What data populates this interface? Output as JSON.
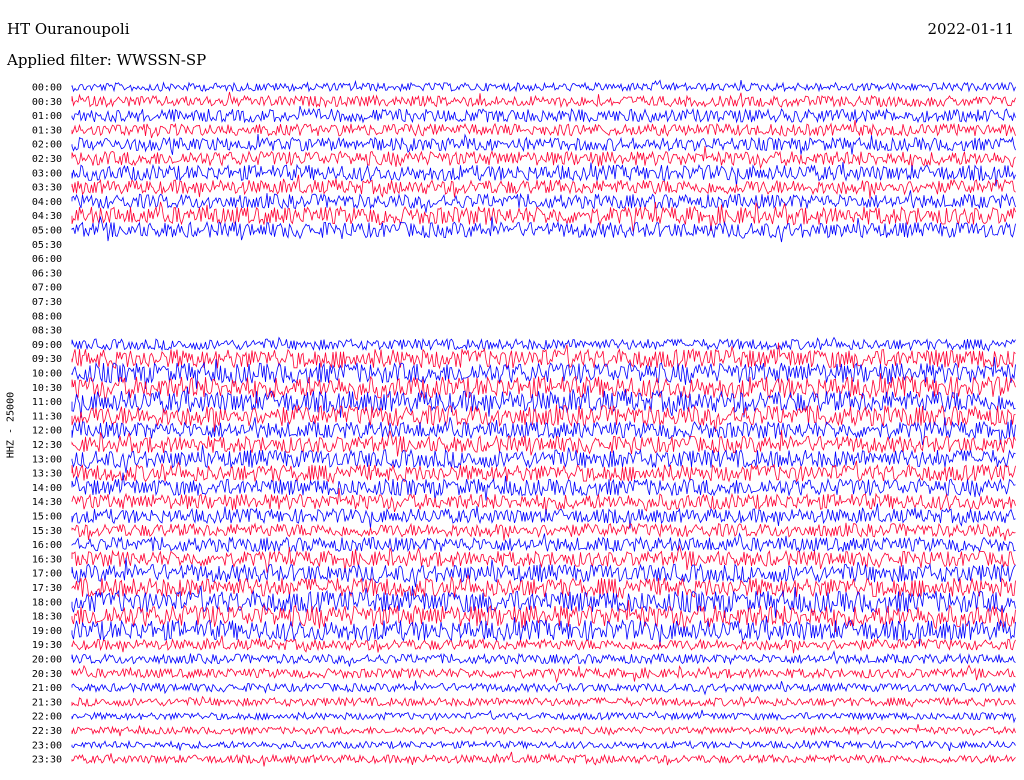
{
  "header": {
    "station": "HT Ouranoupoli",
    "date": "2022-01-11",
    "filter": "Applied filter: WWSSN-SP"
  },
  "chart_data": {
    "type": "line",
    "title": "HT Ouranoupoli",
    "ylabel": "HHZ - 25000",
    "series_colors": [
      "#0000ff",
      "#ff0033"
    ],
    "rows": [
      {
        "time": "00:00",
        "level": 0.35
      },
      {
        "time": "00:30",
        "level": 0.45
      },
      {
        "time": "01:00",
        "level": 0.55
      },
      {
        "time": "01:30",
        "level": 0.5
      },
      {
        "time": "02:00",
        "level": 0.55
      },
      {
        "time": "02:30",
        "level": 0.6
      },
      {
        "time": "03:00",
        "level": 0.65
      },
      {
        "time": "03:30",
        "level": 0.6
      },
      {
        "time": "04:00",
        "level": 0.6
      },
      {
        "time": "04:30",
        "level": 0.75
      },
      {
        "time": "05:00",
        "level": 0.65
      },
      {
        "time": "05:30",
        "level": 0
      },
      {
        "time": "06:00",
        "level": 0
      },
      {
        "time": "06:30",
        "level": 0
      },
      {
        "time": "07:00",
        "level": 0
      },
      {
        "time": "07:30",
        "level": 0
      },
      {
        "time": "08:00",
        "level": 0
      },
      {
        "time": "08:30",
        "level": 0
      },
      {
        "time": "09:00",
        "level": 0.45
      },
      {
        "time": "09:30",
        "level": 0.8
      },
      {
        "time": "10:00",
        "level": 0.85
      },
      {
        "time": "10:30",
        "level": 0.9
      },
      {
        "time": "11:00",
        "level": 0.9
      },
      {
        "time": "11:30",
        "level": 0.85
      },
      {
        "time": "12:00",
        "level": 0.7
      },
      {
        "time": "12:30",
        "level": 0.7
      },
      {
        "time": "13:00",
        "level": 0.75
      },
      {
        "time": "13:30",
        "level": 0.7
      },
      {
        "time": "14:00",
        "level": 0.7
      },
      {
        "time": "14:30",
        "level": 0.65
      },
      {
        "time": "15:00",
        "level": 0.6
      },
      {
        "time": "15:30",
        "level": 0.55
      },
      {
        "time": "16:00",
        "level": 0.6
      },
      {
        "time": "16:30",
        "level": 0.65
      },
      {
        "time": "17:00",
        "level": 0.75
      },
      {
        "time": "17:30",
        "level": 0.8
      },
      {
        "time": "18:00",
        "level": 0.9
      },
      {
        "time": "18:30",
        "level": 0.9
      },
      {
        "time": "19:00",
        "level": 0.85
      },
      {
        "time": "19:30",
        "level": 0.45
      },
      {
        "time": "20:00",
        "level": 0.4
      },
      {
        "time": "20:30",
        "level": 0.4
      },
      {
        "time": "21:00",
        "level": 0.35
      },
      {
        "time": "21:30",
        "level": 0.35
      },
      {
        "time": "22:00",
        "level": 0.3
      },
      {
        "time": "22:30",
        "level": 0.3
      },
      {
        "time": "23:00",
        "level": 0.3
      },
      {
        "time": "23:30",
        "level": 0.35
      }
    ]
  }
}
